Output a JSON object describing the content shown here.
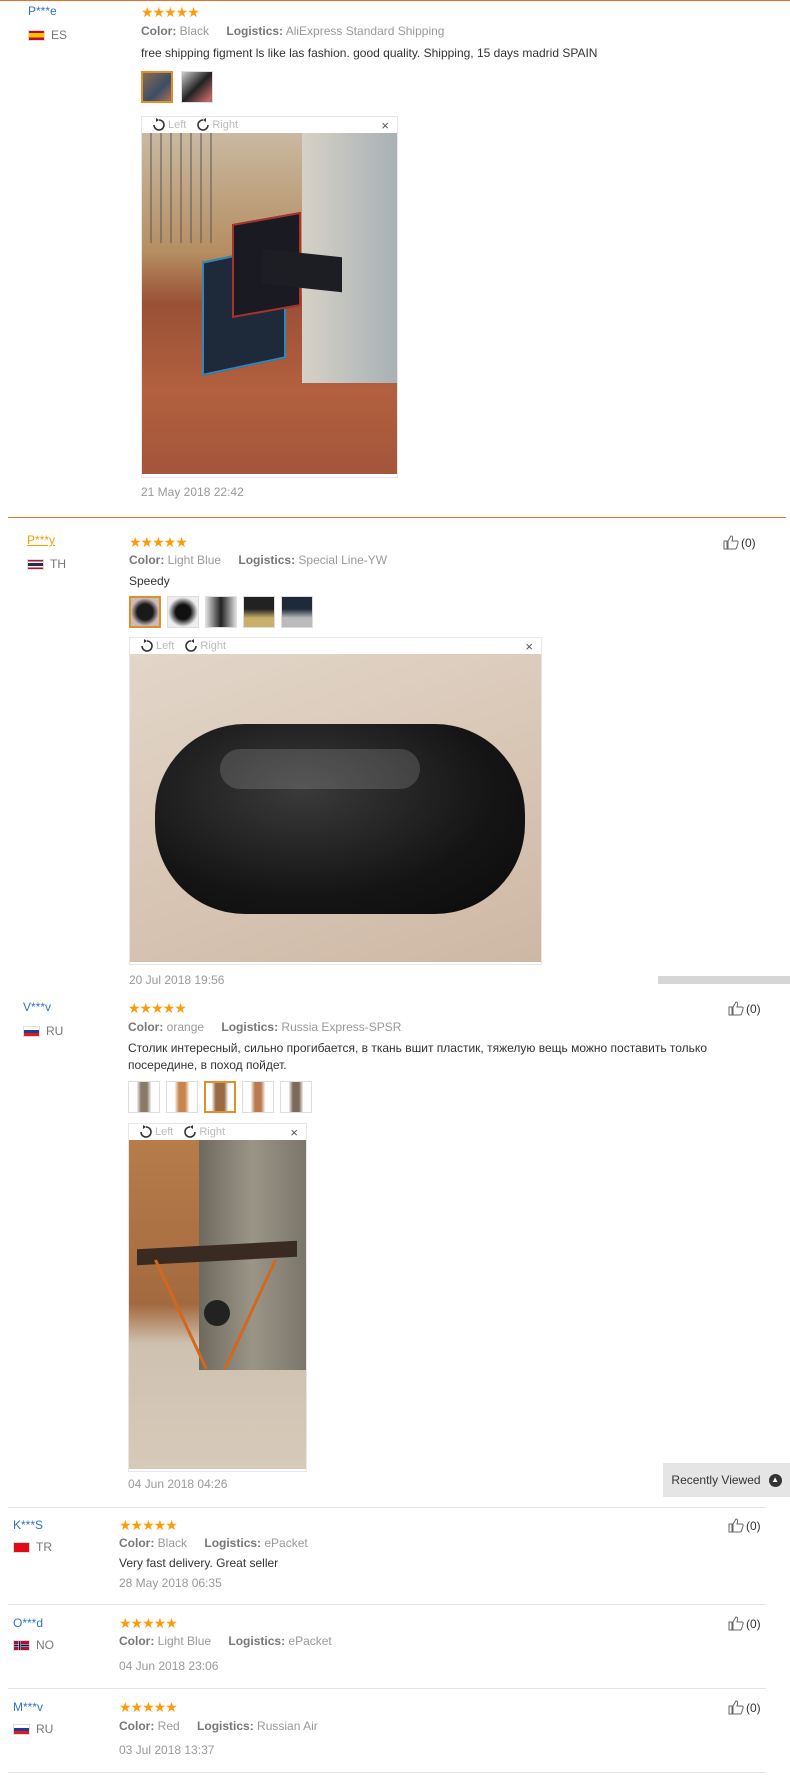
{
  "reviews": [
    {
      "user": "P***e",
      "country": "ES",
      "stars": "★★★★★",
      "color_label": "Color:",
      "color": "Black",
      "logistics_label": "Logistics:",
      "logistics": "AliExpress Standard Shipping",
      "text": "free shipping figment ls like las fashion. good quality. Shipping, 15 days madrid SPAIN",
      "date": "21 May 2018 22:42"
    },
    {
      "user": "P***y",
      "country": "TH",
      "stars": "★★★★★",
      "color_label": "Color:",
      "color": "Light Blue",
      "logistics_label": "Logistics:",
      "logistics": "Special Line-YW",
      "text": "Speedy",
      "date": "20 Jul 2018 19:56",
      "likes": "(0)"
    },
    {
      "user": "V***v",
      "country": "RU",
      "stars": "★★★★★",
      "color_label": "Color:",
      "color": "orange",
      "logistics_label": "Logistics:",
      "logistics": "Russia Express-SPSR",
      "text": "Столик интересный, сильно прогибается, в ткань вшит пластик, тяжелую вещь можно поставить только посередине, в поход пойдет.",
      "date": "04 Jun 2018 04:26",
      "likes": "(0)"
    },
    {
      "user": "K***S",
      "country": "TR",
      "stars": "★★★★★",
      "color_label": "Color:",
      "color": "Black",
      "logistics_label": "Logistics:",
      "logistics": "ePacket",
      "text": "Very fast delivery. Great seller",
      "date": "28 May 2018 06:35",
      "likes": "(0)"
    },
    {
      "user": "O***d",
      "country": "NO",
      "stars": "★★★★★",
      "color_label": "Color:",
      "color": "Light Blue",
      "logistics_label": "Logistics:",
      "logistics": "ePacket",
      "date": "04 Jun 2018 23:06",
      "likes": "(0)"
    },
    {
      "user": "M***v",
      "country": "RU",
      "stars": "★★★★★",
      "color_label": "Color:",
      "color": "Red",
      "logistics_label": "Logistics:",
      "logistics": "Russian Air",
      "date": "03 Jul 2018 13:37",
      "likes": "(0)"
    }
  ],
  "viewer": {
    "left": "Left",
    "right": "Right",
    "close": "×"
  },
  "recently_viewed": "Recently Viewed",
  "colors": {
    "accent": "#e0702a",
    "star": "#ff9b0a",
    "link": "#2f73c8"
  }
}
